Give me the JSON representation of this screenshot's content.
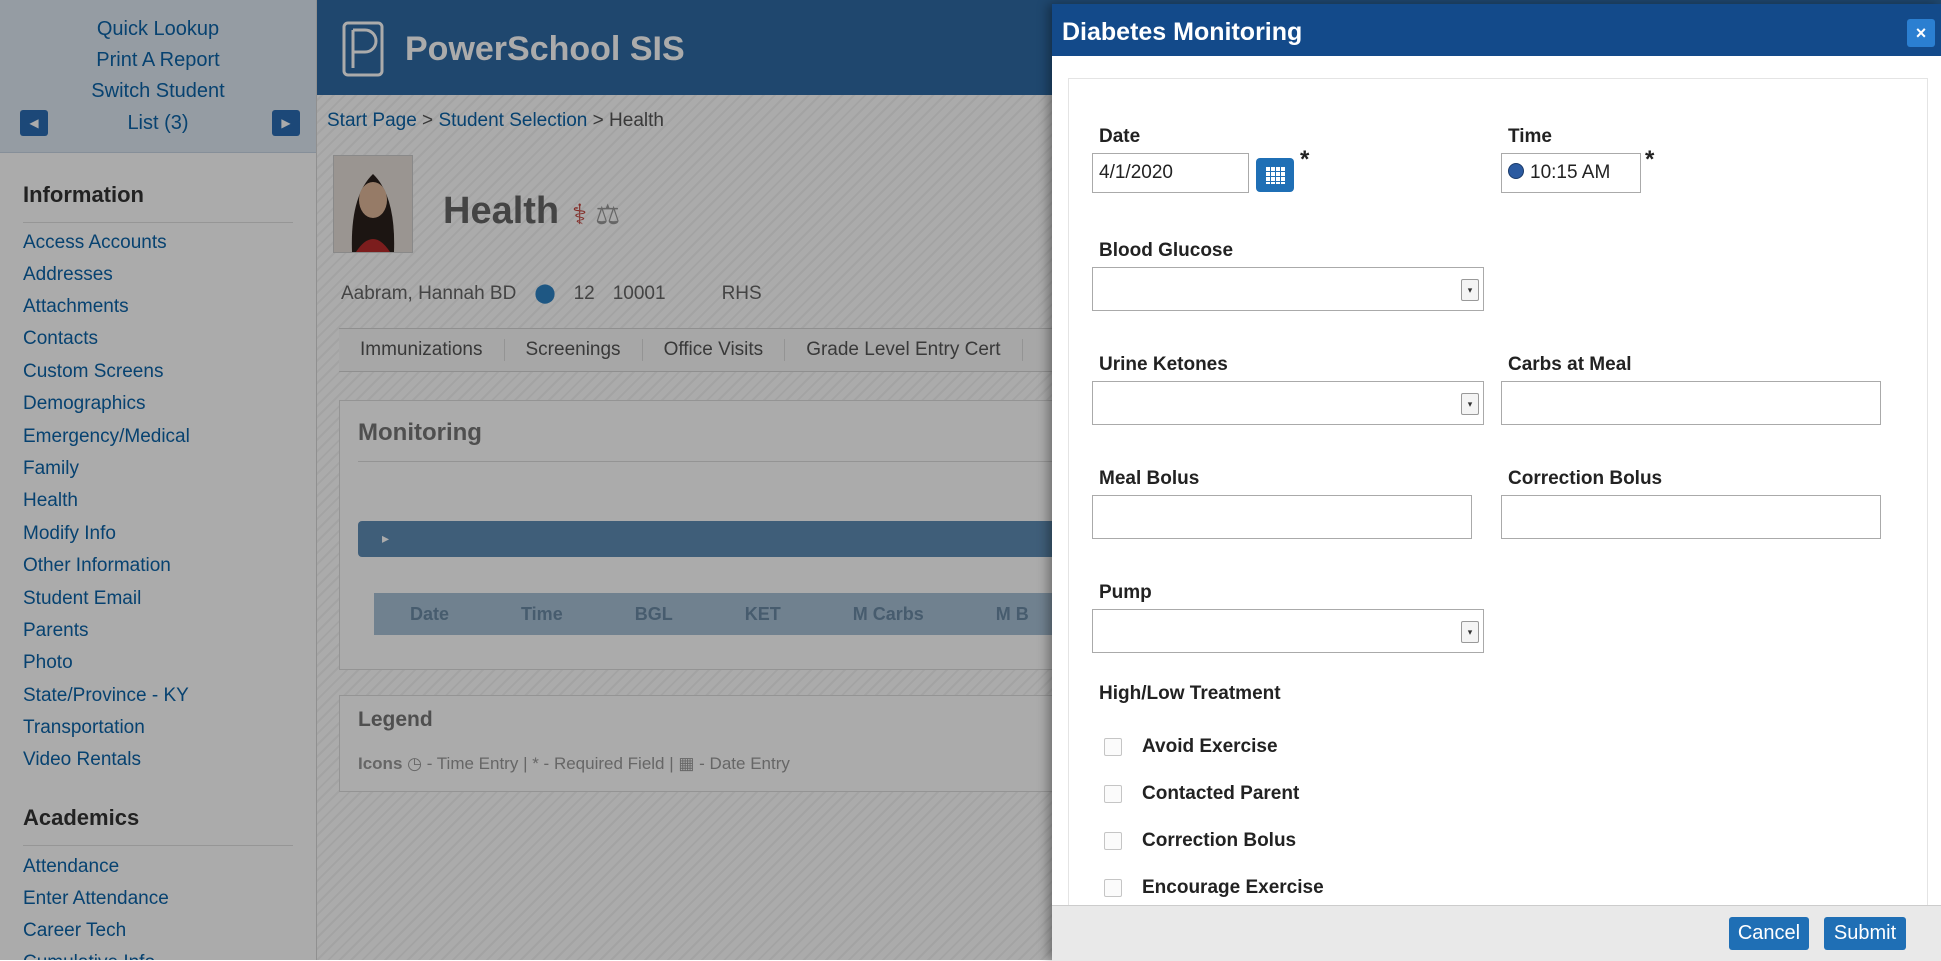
{
  "sidebar": {
    "top_links": [
      "Quick Lookup",
      "Print A Report",
      "Switch Student"
    ],
    "list_label": "List (3)",
    "prev_icon": "caret-left-icon",
    "next_icon": "caret-right-icon",
    "sections": [
      {
        "heading": "Information",
        "items": [
          "Access Accounts",
          "Addresses",
          "Attachments",
          "Contacts",
          "Custom Screens",
          "Demographics",
          "Emergency/Medical",
          "Family",
          "Health",
          "Modify Info",
          "Other Information",
          "Student Email",
          "Parents",
          "Photo",
          "State/Province - KY",
          "Transportation",
          "Video Rentals"
        ]
      },
      {
        "heading": "Academics",
        "items": [
          "Attendance",
          "Enter Attendance",
          "Career Tech",
          "Cumulative Info"
        ]
      }
    ]
  },
  "header": {
    "brand": "PowerSchool SIS"
  },
  "breadcrumb": {
    "start": "Start Page",
    "sep1": " > ",
    "selection": "Student Selection",
    "sep2": " > ",
    "current": "Health"
  },
  "page": {
    "title": "Health",
    "student": {
      "name": "Aabram, Hannah BD",
      "grade": "12",
      "id": "10001",
      "school": "RHS"
    },
    "tabs": [
      "Immunizations",
      "Screenings",
      "Office Visits",
      "Grade Level Entry Cert"
    ],
    "monitoring": {
      "title": "Monitoring",
      "columns": [
        "Date",
        "Time",
        "BGL",
        "KET",
        "M Carbs",
        "M B"
      ]
    },
    "legend": {
      "title": "Legend",
      "icons_label": "Icons",
      "time_entry": "- Time Entry",
      "sep": " | ",
      "required": "* - Required Field",
      "date_entry": "- Date Entry"
    }
  },
  "dialog": {
    "title": "Diabetes Monitoring",
    "close_label": "×",
    "date_label": "Date",
    "date_value": "4/1/2020",
    "time_label": "Time",
    "time_value": "10:15 AM",
    "required_marker": "*",
    "blood_glucose_label": "Blood Glucose",
    "urine_ketones_label": "Urine Ketones",
    "carbs_label": "Carbs at Meal",
    "meal_bolus_label": "Meal Bolus",
    "correction_bolus_label": "Correction Bolus",
    "pump_label": "Pump",
    "treatment_label": "High/Low Treatment",
    "treatments": [
      "Avoid Exercise",
      "Contacted Parent",
      "Correction Bolus",
      "Encourage Exercise"
    ],
    "cancel_label": "Cancel",
    "submit_label": "Submit"
  }
}
